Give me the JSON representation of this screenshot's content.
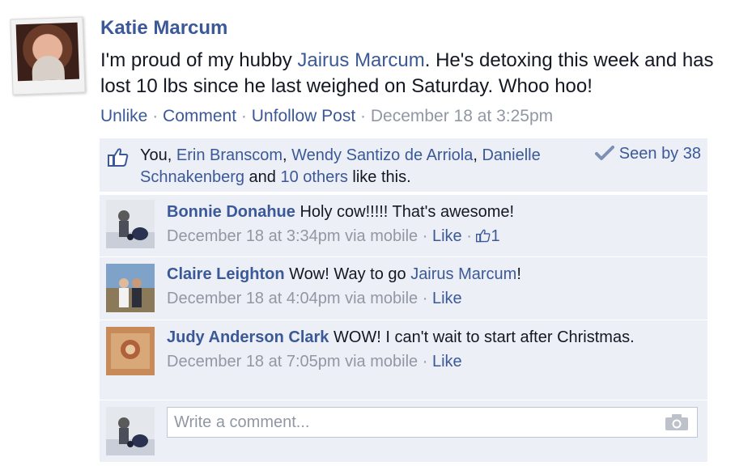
{
  "post": {
    "author": "Katie Marcum",
    "text_before": "I'm proud of my hubby ",
    "tagged": "Jairus Marcum",
    "text_after": ". He's detoxing this week and has lost 10 lbs since he last weighed on Saturday. Whoo hoo!",
    "actions": {
      "unlike": "Unlike",
      "comment": "Comment",
      "unfollow": "Unfollow Post",
      "separator": "·",
      "timestamp": "December 18 at 3:25pm"
    }
  },
  "likes": {
    "you": "You, ",
    "people": [
      "Erin Branscom",
      "Wendy Santizo de Arriola",
      "Danielle Schnakenberg"
    ],
    "comma": ", ",
    "and": " and ",
    "others": "10 others",
    "suffix": " like this.",
    "seen_by": "Seen by 38"
  },
  "comments": [
    {
      "author": "Bonnie Donahue",
      "text": " Holy cow!!!!! That's awesome!",
      "time": "December 18 at 3:34pm via mobile",
      "like": "Like",
      "like_count": "1"
    },
    {
      "author": "Claire Leighton",
      "text_before": " Wow! Way to go ",
      "tagged": "Jairus Marcum",
      "text_after": "!",
      "time": "December 18 at 4:04pm via mobile",
      "like": "Like"
    },
    {
      "author": "Judy Anderson Clark",
      "text": " WOW! I can't wait to start after Christmas.",
      "time": "December 18 at 7:05pm via mobile",
      "like": "Like"
    }
  ],
  "reply": {
    "placeholder": "Write a comment..."
  },
  "colors": {
    "link": "#3b5998",
    "meta": "#9197a3",
    "ufi_bg": "#eceff5"
  }
}
